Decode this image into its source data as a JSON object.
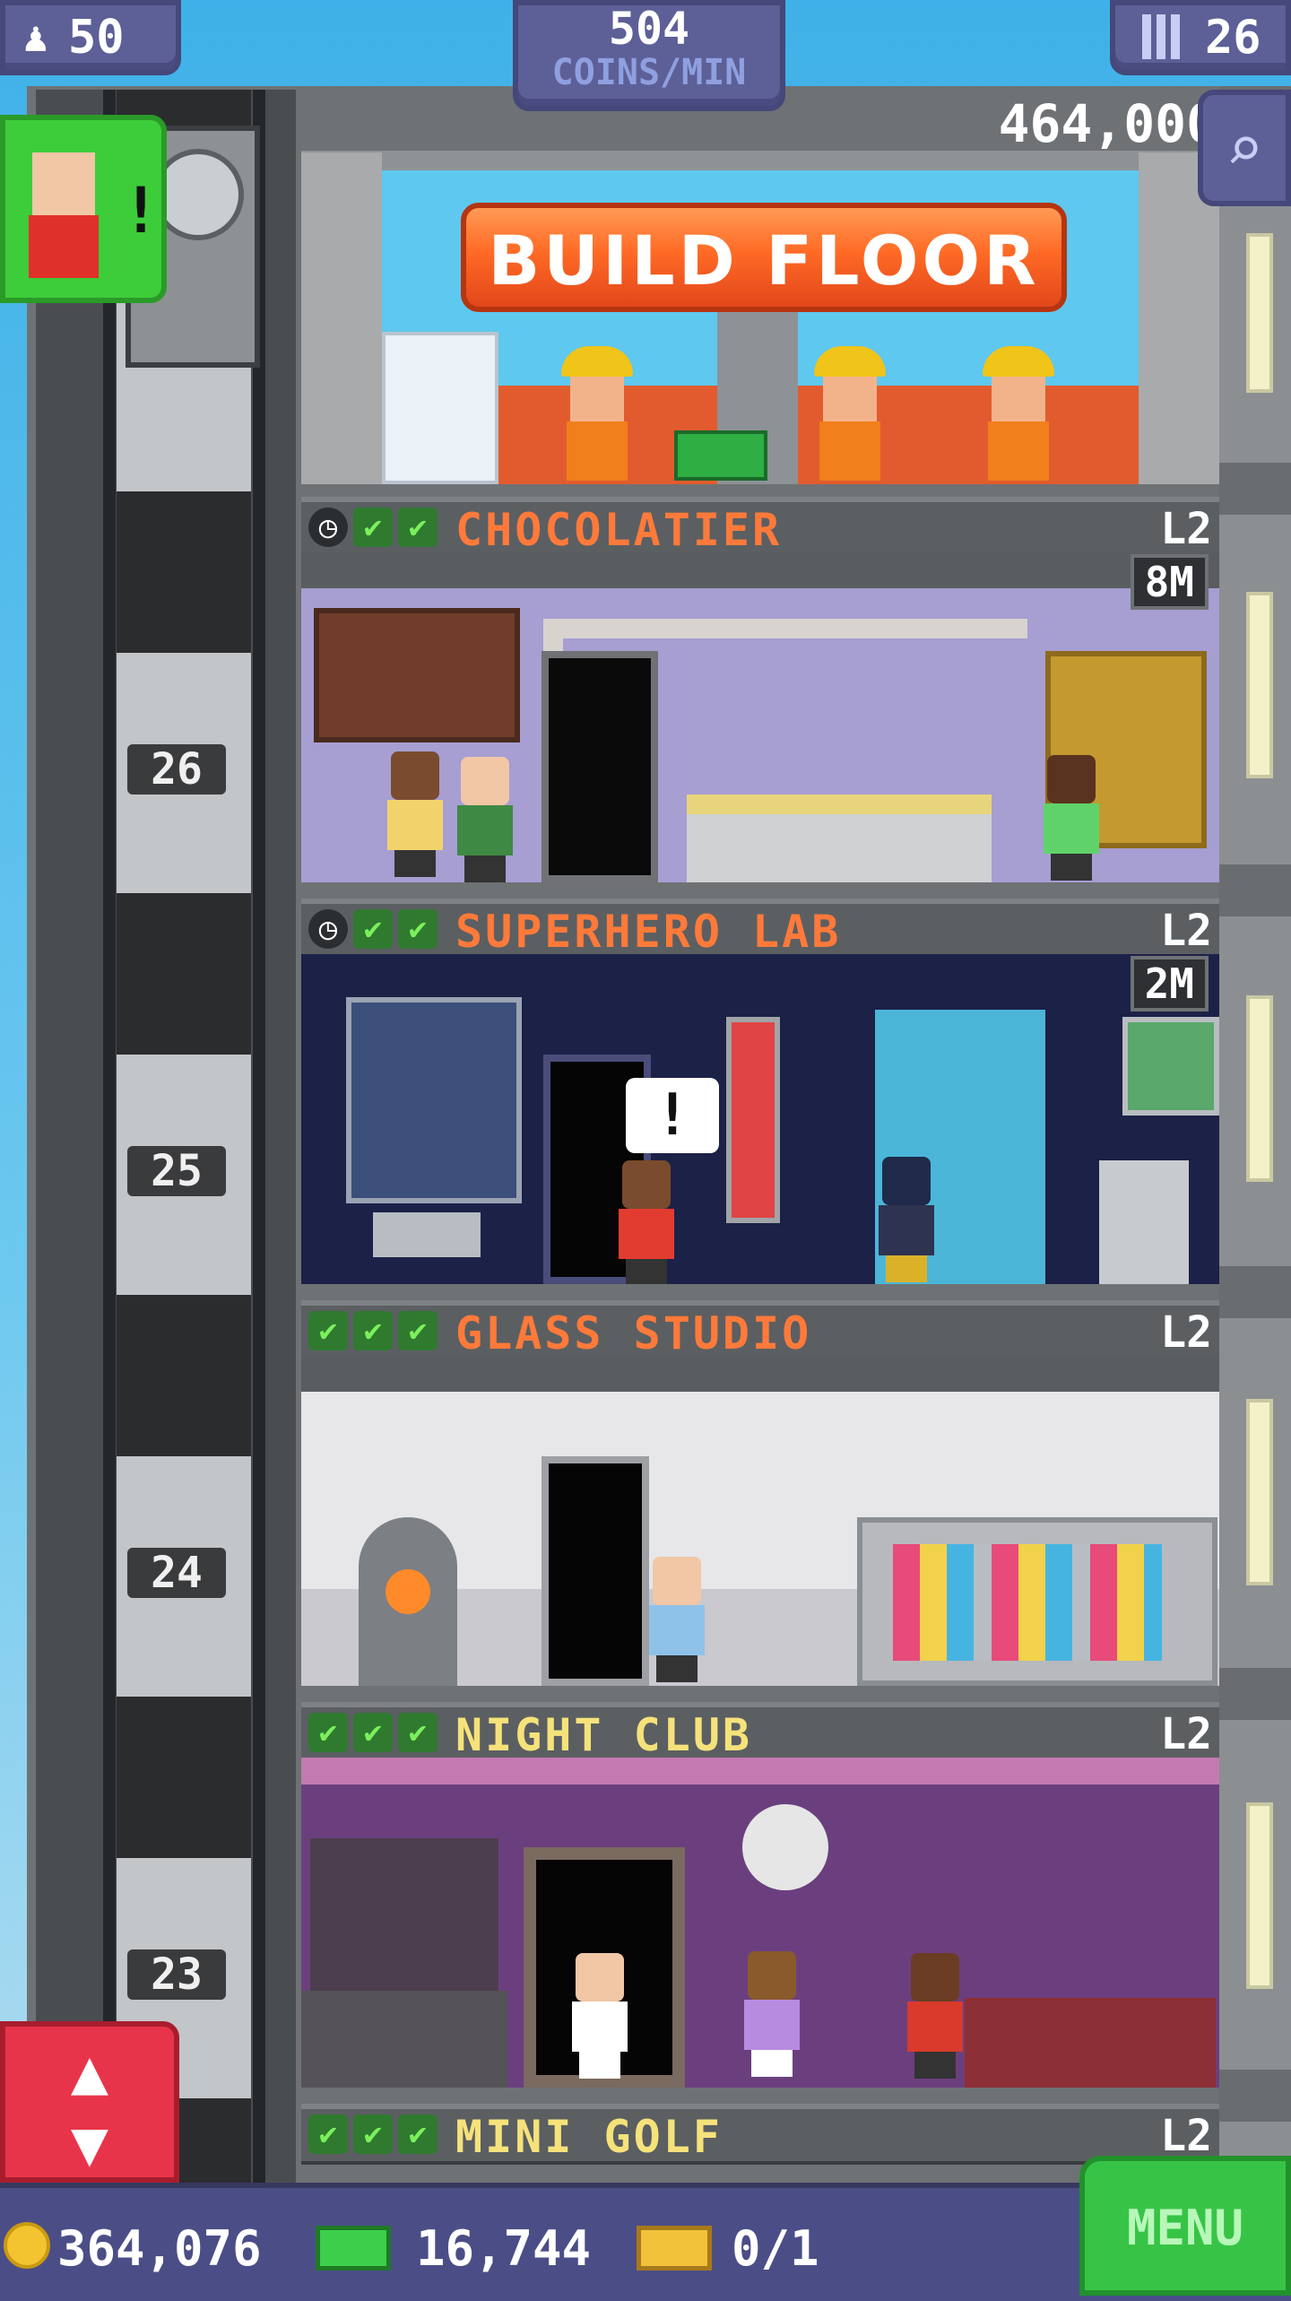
{
  "hud": {
    "population": "50",
    "coins_per_min": "504",
    "coins_per_min_label": "COINS/MIN",
    "floors": "26"
  },
  "build": {
    "label": "BUILD FLOOR",
    "cost": "464,000"
  },
  "floors": [
    {
      "number": "26",
      "name": "CHOCOLATIER",
      "level": "L2",
      "timer": "8M",
      "status": [
        "clock-icon",
        "check-icon",
        "check-icon"
      ],
      "name_color": "#ff7a3a"
    },
    {
      "number": "25",
      "name": "SUPERHERO LAB",
      "level": "L2",
      "timer": "2M",
      "status": [
        "clock-icon",
        "check-icon",
        "check-icon"
      ],
      "name_color": "#ff7a3a"
    },
    {
      "number": "24",
      "name": "GLASS STUDIO",
      "level": "L2",
      "timer": "",
      "status": [
        "check-icon",
        "check-icon",
        "check-icon"
      ],
      "name_color": "#ff7a3a"
    },
    {
      "number": "23",
      "name": "NIGHT CLUB",
      "level": "L2",
      "timer": "",
      "status": [
        "check-icon",
        "check-icon",
        "check-icon"
      ],
      "name_color": "#f5e27a"
    },
    {
      "number": "",
      "name": "MINI GOLF",
      "level": "L2",
      "timer": "",
      "status": [
        "check-icon",
        "check-icon",
        "check-icon"
      ],
      "name_color": "#f5e27a"
    }
  ],
  "alert": {
    "mark": "!"
  },
  "speech_bubble": {
    "mark": "!"
  },
  "bottom": {
    "coins": "364,076",
    "bux": "16,744",
    "tickets": "0/1",
    "menu_label": "MENU"
  },
  "icons": {
    "population": "person-icon",
    "floors": "building-icon",
    "search": "magnifier-icon",
    "elevator": "up-down-arrows-icon"
  }
}
